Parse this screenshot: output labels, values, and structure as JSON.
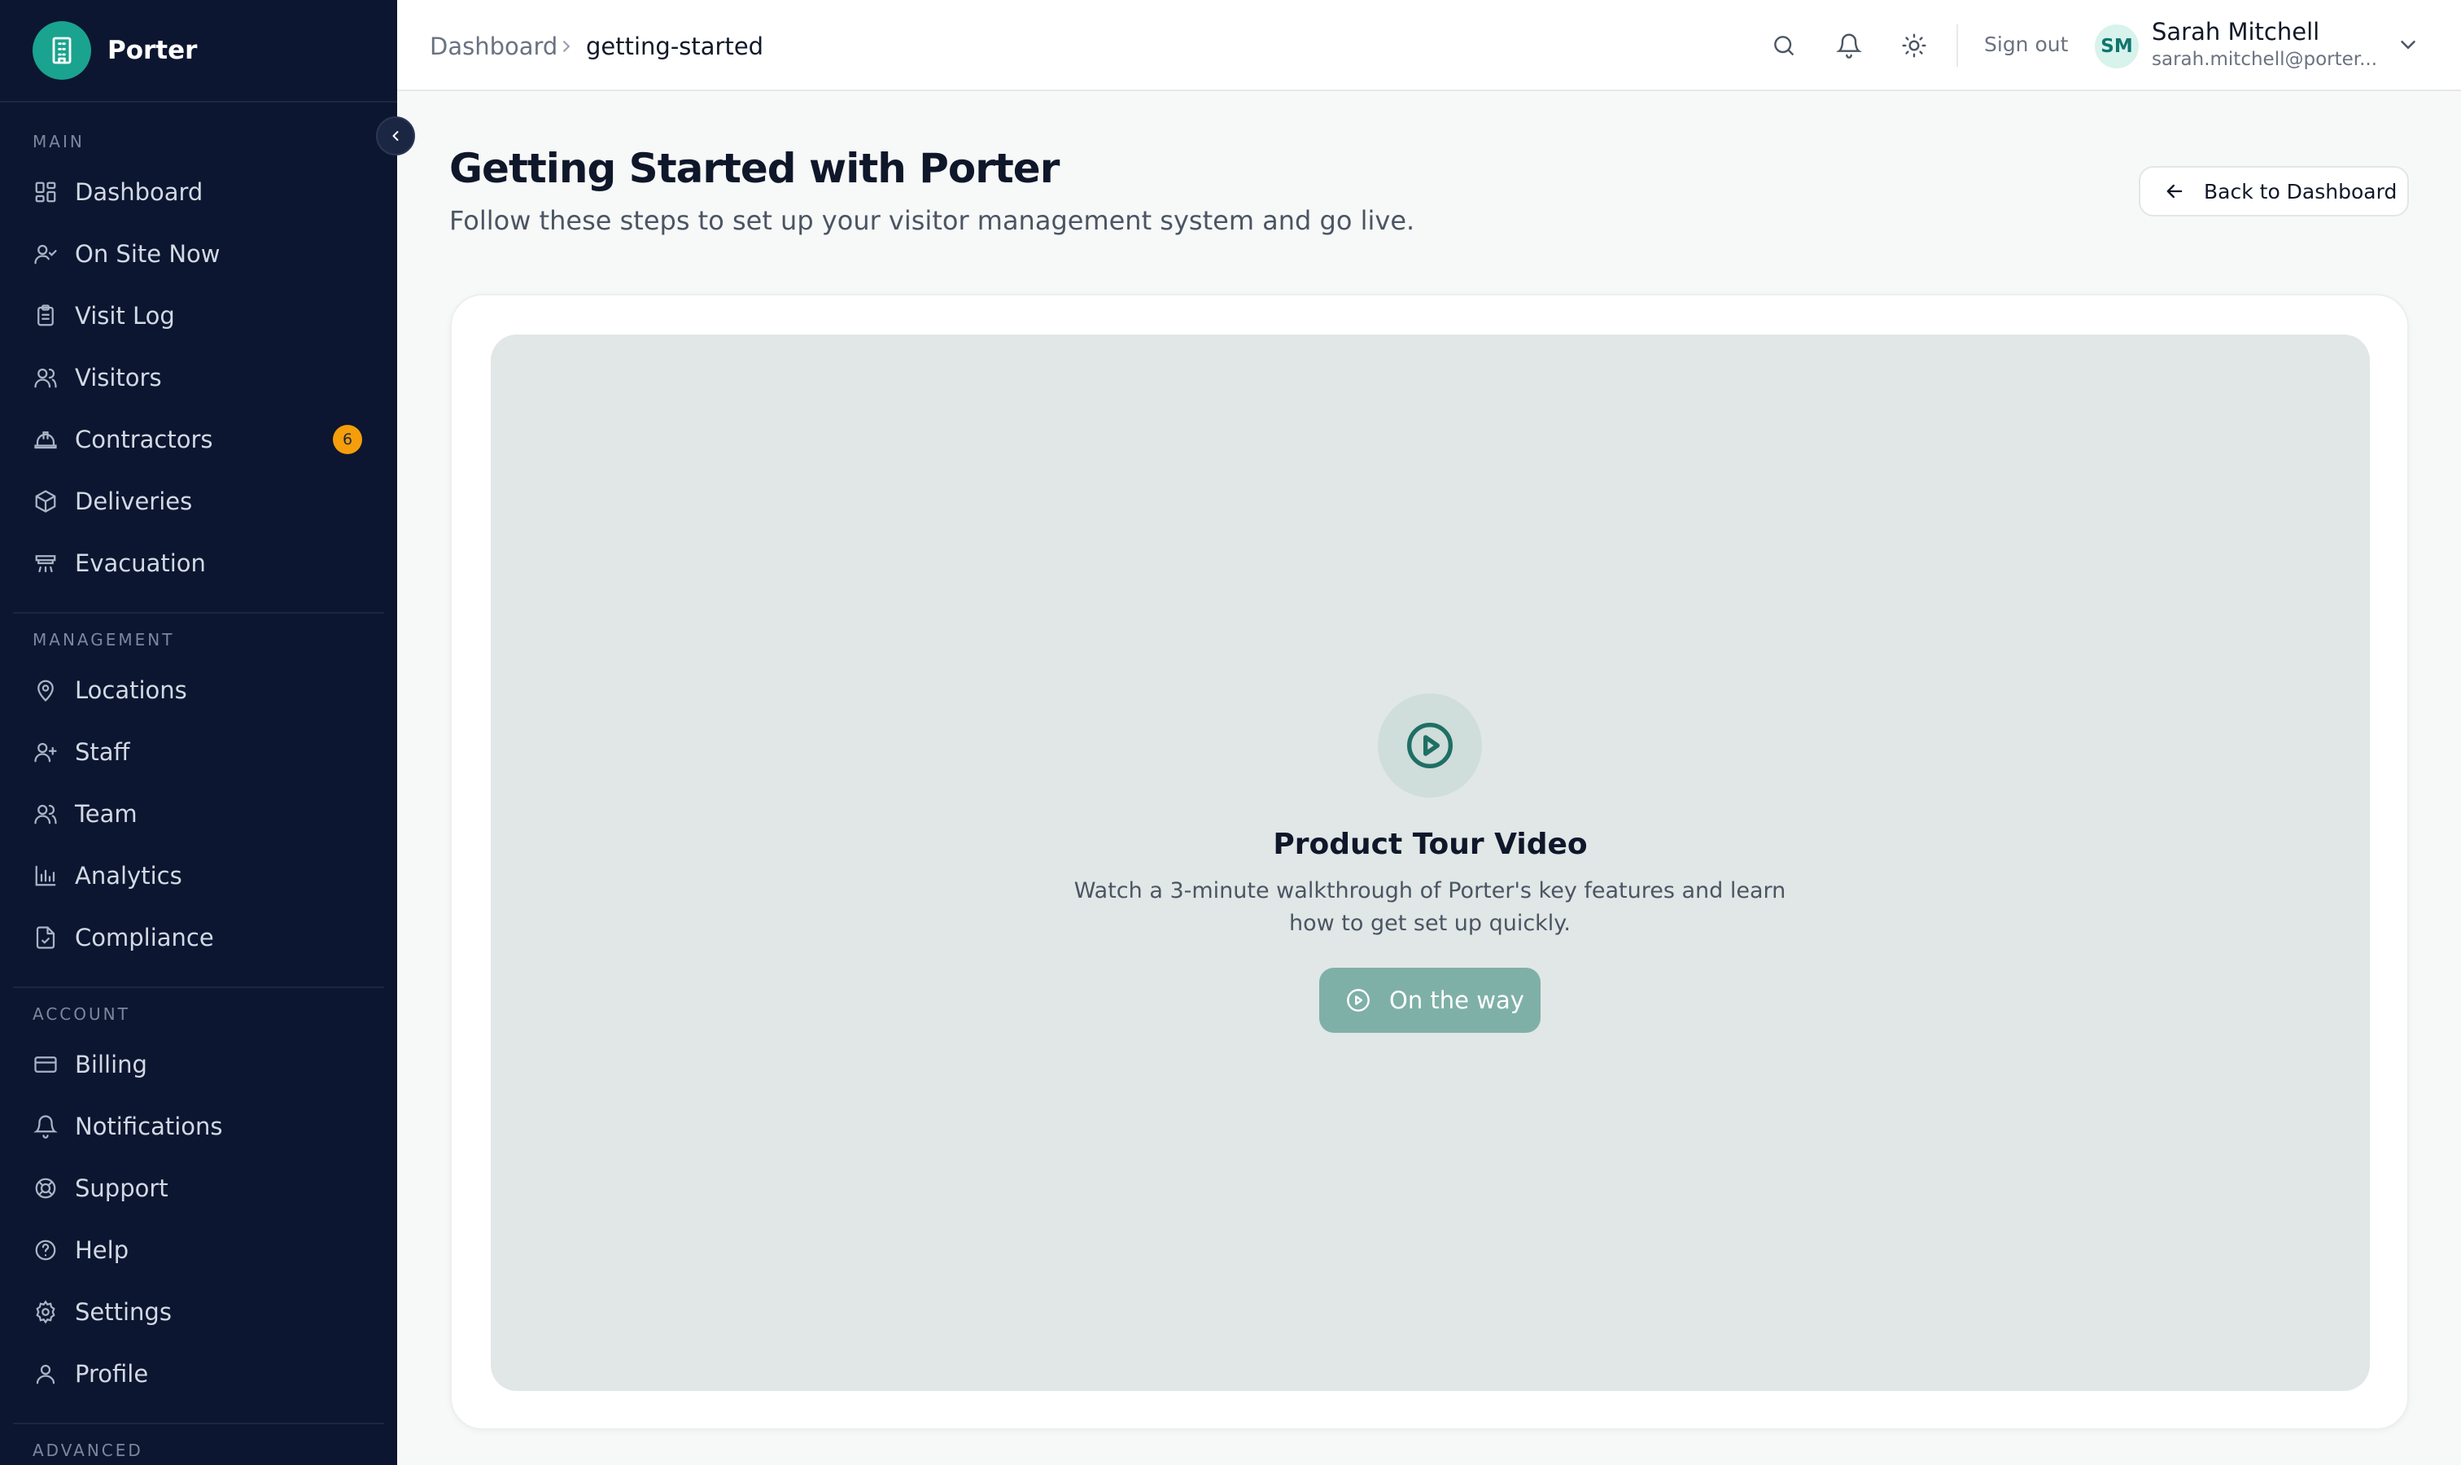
{
  "brand": {
    "name": "Porter"
  },
  "sidebar": {
    "sections": [
      {
        "title": "MAIN",
        "items": [
          {
            "label": "Dashboard",
            "icon": "grid-icon"
          },
          {
            "label": "On Site Now",
            "icon": "user-check-icon"
          },
          {
            "label": "Visit Log",
            "icon": "clipboard-icon"
          },
          {
            "label": "Visitors",
            "icon": "users-icon"
          },
          {
            "label": "Contractors",
            "icon": "hard-hat-icon",
            "badge": "6"
          },
          {
            "label": "Deliveries",
            "icon": "package-icon"
          },
          {
            "label": "Evacuation",
            "icon": "alarm-icon"
          }
        ]
      },
      {
        "title": "MANAGEMENT",
        "items": [
          {
            "label": "Locations",
            "icon": "map-pin-icon"
          },
          {
            "label": "Staff",
            "icon": "user-plus-icon"
          },
          {
            "label": "Team",
            "icon": "users-icon"
          },
          {
            "label": "Analytics",
            "icon": "bar-chart-icon"
          },
          {
            "label": "Compliance",
            "icon": "file-check-icon"
          }
        ]
      },
      {
        "title": "ACCOUNT",
        "items": [
          {
            "label": "Billing",
            "icon": "credit-card-icon"
          },
          {
            "label": "Notifications",
            "icon": "bell-icon"
          },
          {
            "label": "Support",
            "icon": "lifebuoy-icon"
          },
          {
            "label": "Help",
            "icon": "help-circle-icon"
          },
          {
            "label": "Settings",
            "icon": "gear-icon"
          },
          {
            "label": "Profile",
            "icon": "user-icon"
          }
        ]
      },
      {
        "title": "ADVANCED",
        "items": []
      }
    ]
  },
  "header": {
    "breadcrumb": {
      "root": "Dashboard",
      "current": "getting-started"
    },
    "signout_label": "Sign out",
    "user": {
      "initials": "SM",
      "name": "Sarah Mitchell",
      "email": "sarah.mitchell@porter..."
    }
  },
  "page": {
    "title": "Getting Started with Porter",
    "subtitle": "Follow these steps to set up your visitor management system and go live.",
    "back_label": "Back to Dashboard"
  },
  "video": {
    "title": "Product Tour Video",
    "description": "Watch a 3-minute walkthrough of Porter's key features and learn how to get set up quickly.",
    "button_label": "On the way"
  },
  "colors": {
    "sidebar_bg": "#0c1630",
    "accent": "#1aa38e",
    "badge": "#f59e0b",
    "video_button": "#7fb0a8"
  }
}
